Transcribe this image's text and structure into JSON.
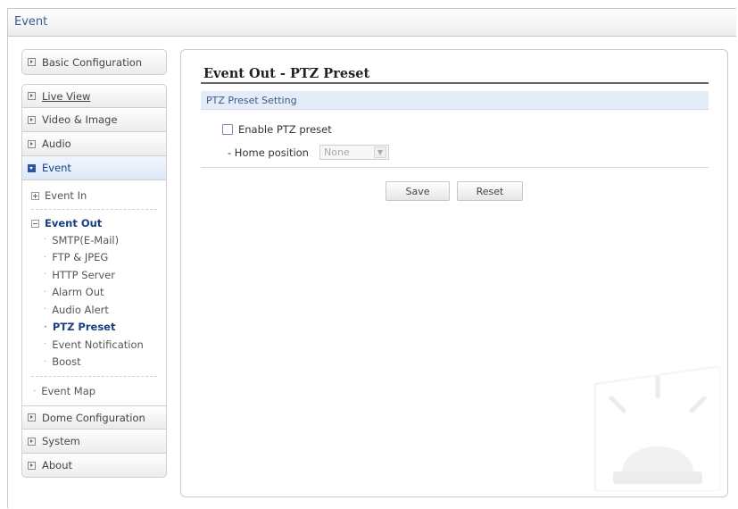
{
  "topbar": {
    "title": "Event"
  },
  "sidebar": {
    "basic_configuration": "Basic Configuration",
    "live_view": "Live View",
    "video_image": "Video & Image",
    "audio": "Audio",
    "event": "Event",
    "event_in": "Event In",
    "event_out": "Event Out",
    "event_out_items": [
      "SMTP(E-Mail)",
      "FTP & JPEG",
      "HTTP Server",
      "Alarm Out",
      "Audio Alert",
      "PTZ Preset",
      "Event Notification",
      "Boost"
    ],
    "event_map": "Event Map",
    "dome_configuration": "Dome Configuration",
    "system": "System",
    "about": "About"
  },
  "content": {
    "title": "Event Out - PTZ Preset",
    "section_title": "PTZ Preset Setting",
    "enable_label": "Enable PTZ preset",
    "enable_checked": false,
    "home_position_label": "- Home position",
    "home_position_value": "None",
    "save_label": "Save",
    "reset_label": "Reset"
  }
}
